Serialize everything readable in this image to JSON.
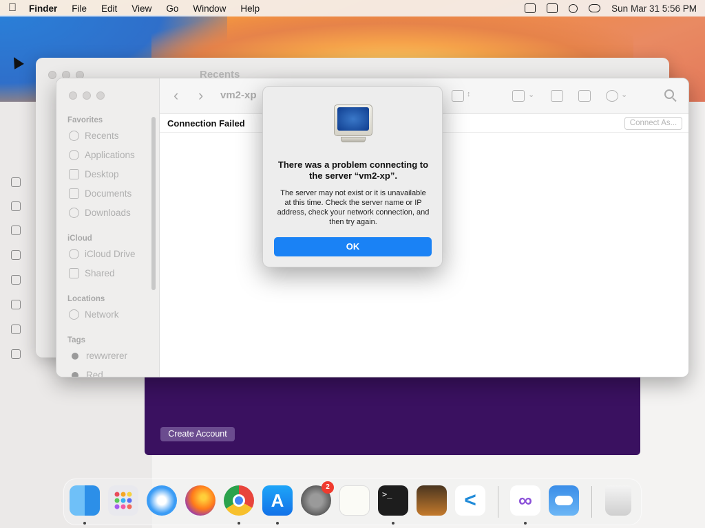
{
  "menubar": {
    "app_name": "Finder",
    "items": [
      "File",
      "Edit",
      "View",
      "Go",
      "Window",
      "Help"
    ],
    "datetime": "Sun Mar 31  5:56 PM"
  },
  "back_window": {
    "title": "Recents"
  },
  "back_app": {
    "create_button": "Create Account"
  },
  "finder": {
    "path_title": "vm2-xp",
    "status_label": "Connection Failed",
    "connect_as_label": "Connect As...",
    "sidebar": {
      "favorites_header": "Favorites",
      "favorites": [
        "Recents",
        "Applications",
        "Desktop",
        "Documents",
        "Downloads"
      ],
      "icloud_header": "iCloud",
      "icloud": [
        "iCloud Drive",
        "Shared"
      ],
      "locations_header": "Locations",
      "locations": [
        "Network"
      ],
      "tags_header": "Tags",
      "tags": [
        "rewwrerer",
        "Red"
      ]
    }
  },
  "alert": {
    "title": "There was a problem connecting to the server “vm2-xp”.",
    "message": "The server may not exist or it is unavailable at this time. Check the server name or IP address, check your network connection, and then try again.",
    "ok_label": "OK"
  },
  "dock": {
    "settings_badge": "2",
    "apps": [
      "finder-icon",
      "launchpad-icon",
      "safari-icon",
      "firefox-icon",
      "chrome-icon",
      "app-store-icon",
      "system-settings-icon",
      "textedit-icon",
      "terminal-icon",
      "garageband-icon",
      "vscode-icon",
      "visual-studio-icon",
      "weather-icon",
      "trash-icon"
    ]
  }
}
